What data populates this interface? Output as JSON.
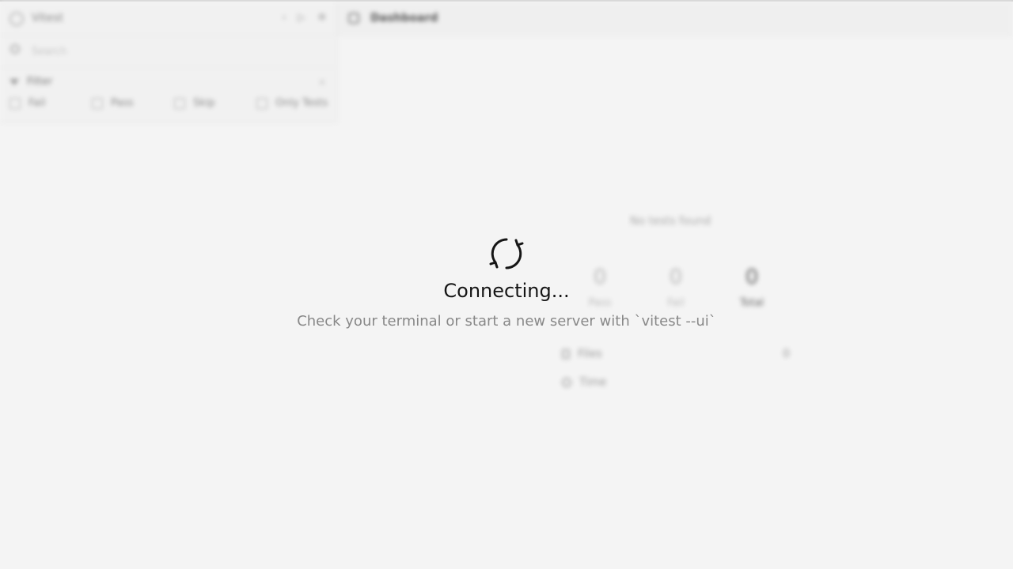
{
  "sidebar": {
    "title": "Vitest",
    "search_placeholder": "Search",
    "filter_label": "Filter",
    "filters": [
      "Fail",
      "Pass",
      "Skip",
      "Only Tests"
    ]
  },
  "header": {
    "title": "Dashboard"
  },
  "dashboard": {
    "empty_message": "No tests found",
    "stats": [
      {
        "value": "0",
        "label": "Pass"
      },
      {
        "value": "0",
        "label": "Fail"
      },
      {
        "value": "0",
        "label": "Total"
      }
    ],
    "files_label": "Files",
    "files_value": "0",
    "time_label": "Time"
  },
  "overlay": {
    "title": "Connecting...",
    "message": "Check your terminal or start a new server with `vitest --ui`"
  }
}
